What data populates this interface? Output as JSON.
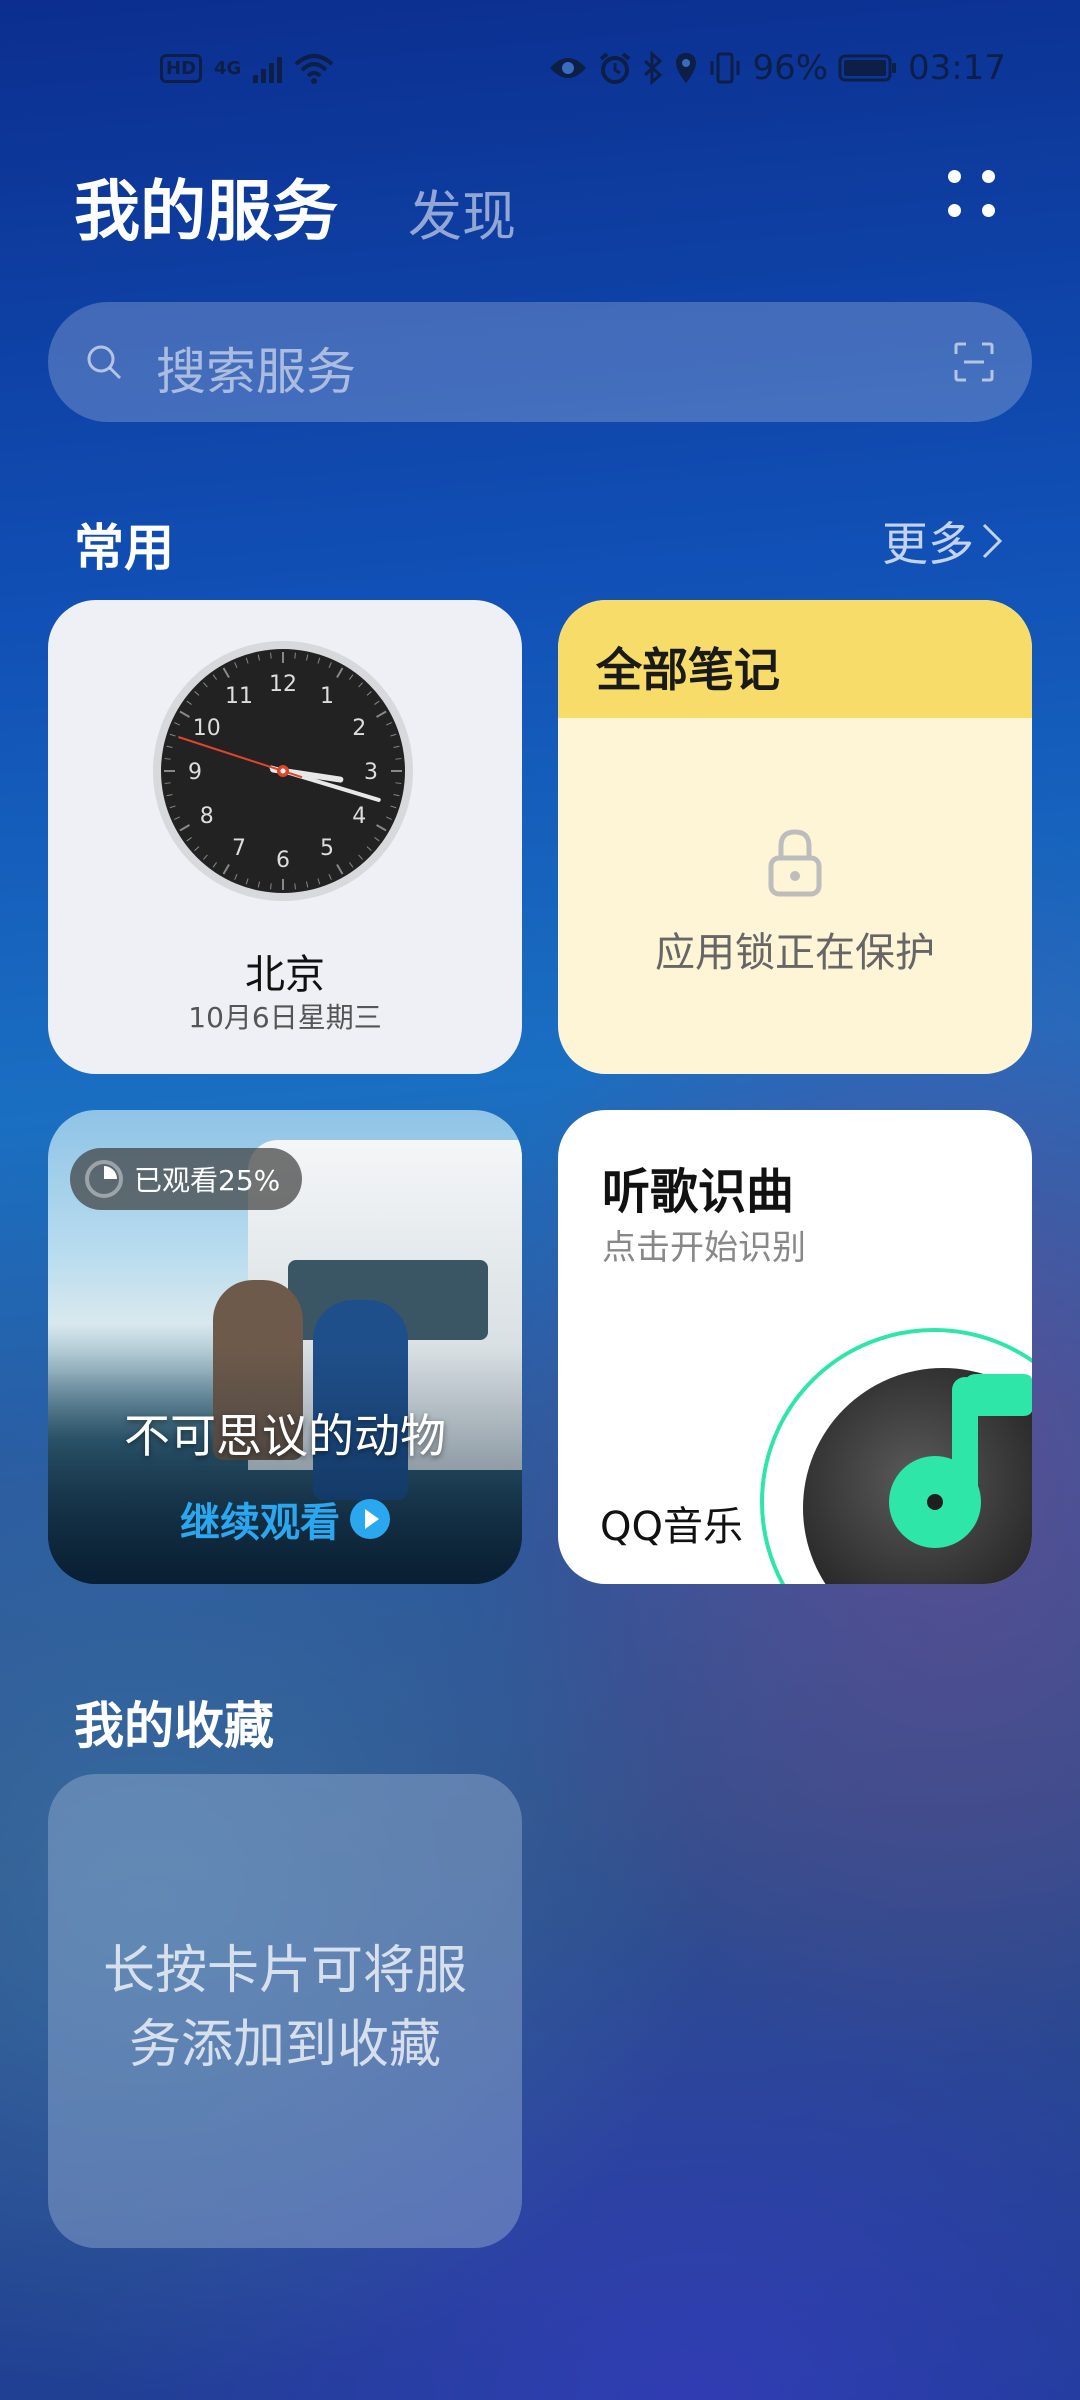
{
  "status_bar": {
    "network": "4G",
    "battery": "96%",
    "time": "03:17",
    "icons": [
      "hd-icon",
      "signal-icon",
      "wifi-icon",
      "eye-icon",
      "alarm-icon",
      "bluetooth-icon",
      "location-icon",
      "vibrate-icon",
      "battery-icon"
    ]
  },
  "header": {
    "title": "我的服务",
    "tab_discover": "发现"
  },
  "search": {
    "placeholder": "搜索服务"
  },
  "common": {
    "title": "常用",
    "more": "更多"
  },
  "clock_card": {
    "city": "北京",
    "date": "10月6日星期三",
    "numbers": [
      "12",
      "1",
      "2",
      "3",
      "4",
      "5",
      "6",
      "7",
      "8",
      "9",
      "10",
      "11"
    ],
    "hour": 3,
    "minute": 17,
    "second": 48
  },
  "notes_card": {
    "title": "全部笔记",
    "locked_text": "应用锁正在保护"
  },
  "video_card": {
    "progress": "已观看25%",
    "progress_value": 0.25,
    "title": "不可思议的动物",
    "action": "继续观看"
  },
  "music_card": {
    "title": "听歌识曲",
    "subtitle": "点击开始识别",
    "app_name": "QQ音乐"
  },
  "favorites": {
    "title": "我的收藏",
    "hint": "长按卡片可将服务添加到收藏"
  },
  "colors": {
    "notes_header": "#f8dc6a",
    "notes_body": "#fdf5d6",
    "music_accent": "#2de6a8",
    "video_cta": "#2aa7ee"
  }
}
